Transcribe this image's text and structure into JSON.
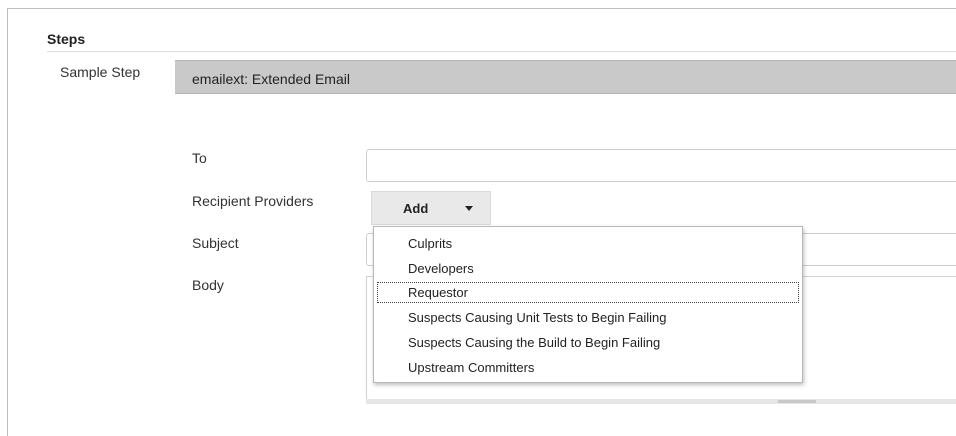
{
  "steps": {
    "title": "Steps",
    "sample_step_label": "Sample Step",
    "sample_step_value": "emailext: Extended Email"
  },
  "form": {
    "to_label": "To",
    "to_value": "",
    "recipient_providers_label": "Recipient Providers",
    "add_button_label": "Add",
    "subject_label": "Subject",
    "subject_value": "",
    "body_label": "Body",
    "body_value": ""
  },
  "dropdown": {
    "items": [
      {
        "label": "Culprits"
      },
      {
        "label": "Developers"
      },
      {
        "label": "Requestor",
        "focused": true
      },
      {
        "label": "Suspects Causing Unit Tests to Begin Failing"
      },
      {
        "label": "Suspects Causing the Build to Begin Failing"
      },
      {
        "label": "Upstream Committers"
      }
    ]
  }
}
